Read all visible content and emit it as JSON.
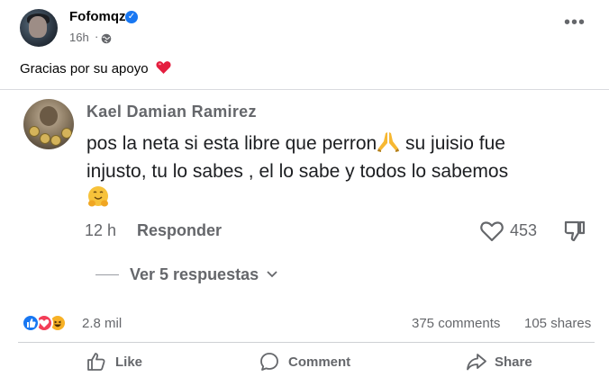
{
  "post": {
    "author": "Fofomqz",
    "time": "16h",
    "separator": "·",
    "more_icon": "more-horizontal-icon",
    "text": "Gracias por su apoyo"
  },
  "comment": {
    "name": "Kael Damian Ramirez",
    "text_line1": "pos la neta si esta libre que perron",
    "text_line1b": " su juisio fue",
    "text_line2": "injusto, tu lo sabes , el lo sabe y todos lo sabemos",
    "time": "12 h",
    "reply_label": "Responder",
    "like_count": "453",
    "view_replies": "Ver 5 respuestas"
  },
  "stats": {
    "reactions_count": "2.8 mil",
    "comments": "375 comments",
    "shares": "105 shares"
  },
  "actions": {
    "like": "Like",
    "comment": "Comment",
    "share": "Share"
  },
  "colors": {
    "accent": "#1877f2",
    "secondary_text": "#65676b",
    "heart_red": "#f02849"
  }
}
